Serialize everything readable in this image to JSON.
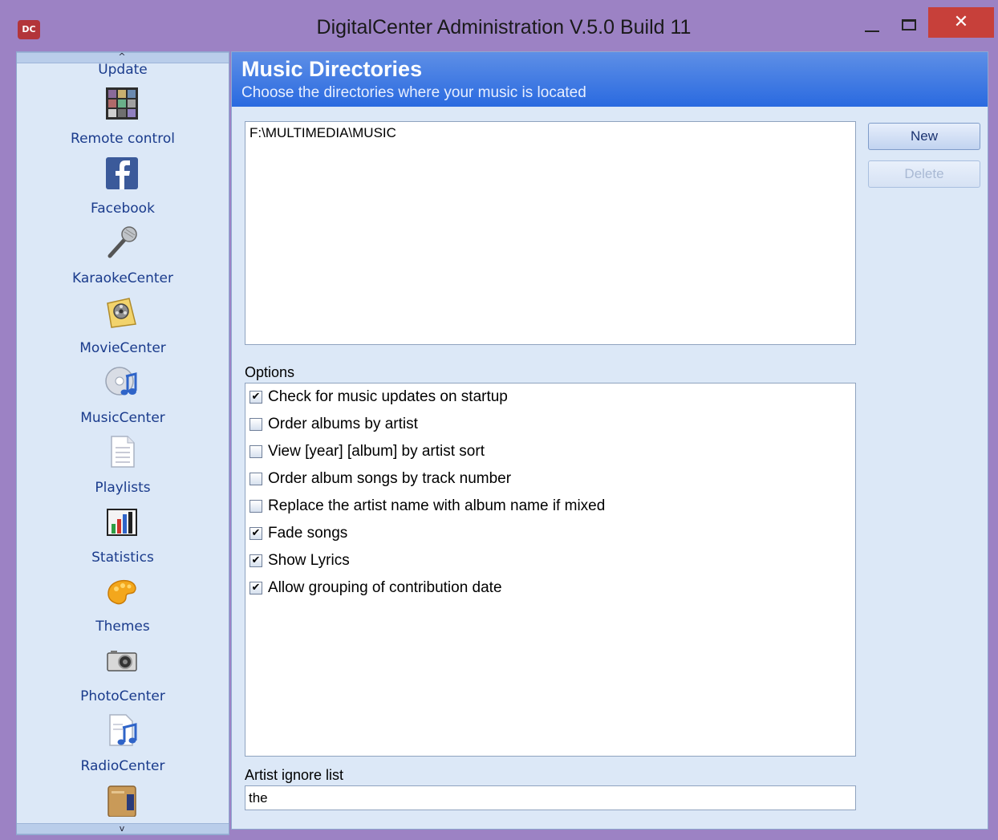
{
  "window": {
    "app_icon_label": "DC",
    "title": "DigitalCenter Administration V.5.0 Build 11",
    "close_glyph": "✕"
  },
  "sidebar": {
    "scroll_up_glyph": "^",
    "scroll_down_glyph": "v",
    "items": [
      {
        "label": "Update",
        "icon": "update-icon"
      },
      {
        "label": "Remote control",
        "icon": "remote-control-icon"
      },
      {
        "label": "Facebook",
        "icon": "facebook-icon"
      },
      {
        "label": "KaraokeCenter",
        "icon": "microphone-icon"
      },
      {
        "label": "MovieCenter",
        "icon": "film-reel-icon"
      },
      {
        "label": "MusicCenter",
        "icon": "music-cd-icon"
      },
      {
        "label": "Playlists",
        "icon": "playlist-document-icon"
      },
      {
        "label": "Statistics",
        "icon": "bar-chart-icon"
      },
      {
        "label": "Themes",
        "icon": "paint-palette-icon"
      },
      {
        "label": "PhotoCenter",
        "icon": "camera-icon"
      },
      {
        "label": "RadioCenter",
        "icon": "music-note-document-icon"
      }
    ]
  },
  "header": {
    "title": "Music Directories",
    "subtitle": "Choose the directories where your music is located"
  },
  "directories": {
    "items": [
      "F:\\MULTIMEDIA\\MUSIC"
    ]
  },
  "buttons": {
    "new_label": "New",
    "delete_label": "Delete"
  },
  "options": {
    "label": "Options",
    "check_glyph": "✔",
    "items": [
      {
        "label": "Check for music updates on startup",
        "checked": true
      },
      {
        "label": "Order albums by artist",
        "checked": false
      },
      {
        "label": "View [year] [album] by artist sort",
        "checked": false
      },
      {
        "label": "Order album songs by track number",
        "checked": false
      },
      {
        "label": "Replace the artist name with album name if mixed",
        "checked": false
      },
      {
        "label": "Fade songs",
        "checked": true
      },
      {
        "label": "Show Lyrics",
        "checked": true
      },
      {
        "label": "Allow grouping of contribution date",
        "checked": true
      }
    ]
  },
  "artist_ignore": {
    "label": "Artist ignore list",
    "value": "the"
  },
  "colors": {
    "banner": "#2a6ae0",
    "window_frame": "#9c82c4",
    "close_button": "#c7403a",
    "panel_bg": "#dce8f7"
  }
}
